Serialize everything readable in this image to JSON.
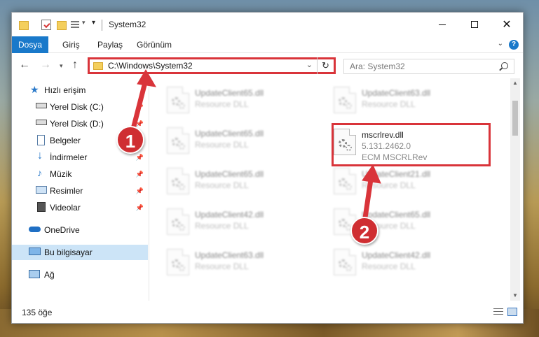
{
  "window": {
    "title": "System32",
    "controls": {
      "minimize": "minimize",
      "maximize": "maximize",
      "close": "✕"
    }
  },
  "ribbon": {
    "tabs": [
      "Dosya",
      "Giriş",
      "Paylaş",
      "Görünüm"
    ],
    "help": "?"
  },
  "nav": {
    "address": "C:\\Windows\\System32",
    "search_placeholder": "Ara: System32"
  },
  "sidebar": {
    "items": [
      {
        "label": "Hızlı erişim",
        "icon": "star-icon",
        "pinned": false
      },
      {
        "label": "Yerel Disk (C:)",
        "icon": "drive-icon",
        "pinned": true
      },
      {
        "label": "Yerel Disk (D:)",
        "icon": "drive-icon",
        "pinned": true
      },
      {
        "label": "Belgeler",
        "icon": "documents-icon",
        "pinned": true
      },
      {
        "label": "İndirmeler",
        "icon": "download-icon",
        "pinned": true
      },
      {
        "label": "Müzik",
        "icon": "music-icon",
        "pinned": true
      },
      {
        "label": "Resimler",
        "icon": "pictures-icon",
        "pinned": true
      },
      {
        "label": "Videolar",
        "icon": "videos-icon",
        "pinned": true
      },
      {
        "label": "OneDrive",
        "icon": "cloud-icon",
        "pinned": false
      },
      {
        "label": "Bu bilgisayar",
        "icon": "computer-icon",
        "pinned": false,
        "selected": true
      },
      {
        "label": "Ağ",
        "icon": "network-icon",
        "pinned": false
      }
    ]
  },
  "files": {
    "left": [
      {
        "name": "UpdateClient65.dll",
        "desc": "Resource DLL"
      },
      {
        "name": "UpdateClient65.dll",
        "desc": "Resource DLL"
      },
      {
        "name": "UpdateClient65.dll",
        "desc": "Resource DLL"
      },
      {
        "name": "UpdateClient42.dll",
        "desc": "Resource DLL"
      },
      {
        "name": "UpdateClient63.dll",
        "desc": "Resource DLL"
      }
    ],
    "right": [
      {
        "name": "UpdateClient63.dll",
        "desc": "Resource DLL"
      },
      {
        "name": "UpdateClient21.dll",
        "desc": "Resource DLL"
      },
      {
        "name": "UpdateClient65.dll",
        "desc": "Resource DLL"
      },
      {
        "name": "UpdateClient42.dll",
        "desc": "Resource DLL"
      }
    ],
    "target": {
      "name": "mscrlrev.dll",
      "version": "5.131.2462.0",
      "desc": "ECM MSCRLRev"
    }
  },
  "status": {
    "count": "135 öğe"
  },
  "annotations": {
    "step1": "1",
    "step2": "2",
    "color": "#d9343a"
  }
}
